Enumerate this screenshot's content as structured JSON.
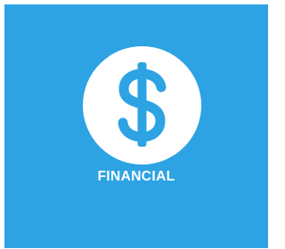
{
  "tile": {
    "label": "FINANCIAL",
    "icon": "dollar-sign-icon",
    "background_color": "#2da3e3",
    "icon_circle_color": "#ffffff",
    "label_color": "#ffffff"
  }
}
